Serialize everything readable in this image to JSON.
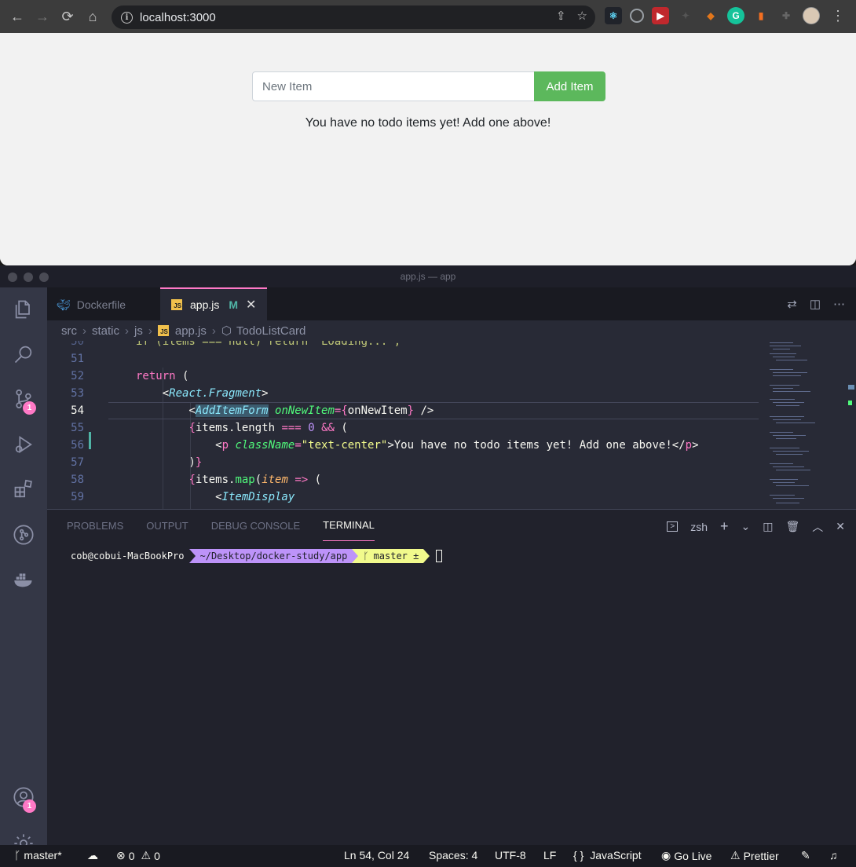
{
  "browser": {
    "url": "localhost:3000",
    "nav": {
      "back": "←",
      "forward": "→",
      "reload": "⟳",
      "home": "⌂"
    }
  },
  "todo": {
    "input_placeholder": "New Item",
    "add_button": "Add Item",
    "empty_message": "You have no todo items yet! Add one above!"
  },
  "vscode": {
    "window_title": "app.js — app",
    "tabs": [
      {
        "label": "Dockerfile"
      },
      {
        "label": "app.js",
        "status": "M"
      }
    ],
    "breadcrumb": [
      "src",
      "static",
      "js",
      "app.js",
      "TodoListCard"
    ],
    "editor": {
      "line_numbers": [
        "51",
        "52",
        "53",
        "54",
        "55",
        "56",
        "57",
        "58",
        "59"
      ],
      "partial_top_line": "if (items === null) return 'Loading...';"
    },
    "scm_badge": "1",
    "accounts_badge": "1",
    "panel": {
      "tabs": [
        "PROBLEMS",
        "OUTPUT",
        "DEBUG CONSOLE",
        "TERMINAL"
      ],
      "active_tab": "TERMINAL",
      "shell": "zsh",
      "prompt_user": "cob@cobui-MacBookPro",
      "prompt_path": "~/Desktop/docker-study/app",
      "prompt_branch": "master ±"
    },
    "statusbar": {
      "branch": "master*",
      "errors": "0",
      "warnings": "0",
      "position": "Ln 54, Col 24",
      "spaces": "Spaces: 4",
      "encoding": "UTF-8",
      "eol": "LF",
      "language": "JavaScript",
      "go_live": "Go Live",
      "prettier": "Prettier"
    }
  },
  "colors": {
    "add_button": "#5cb85c",
    "accent_pink": "#ff79c6",
    "editor_bg": "#282a36"
  }
}
